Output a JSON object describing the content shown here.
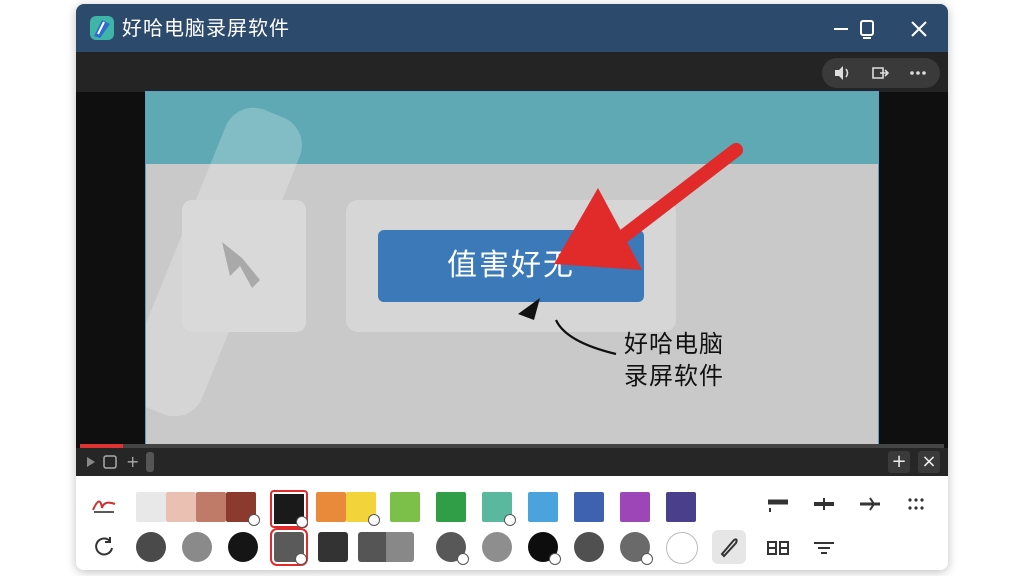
{
  "window": {
    "title": "好哈电脑录屏软件"
  },
  "title_controls": [
    "minimize-icon",
    "maximize-icon",
    "close-icon"
  ],
  "top_toolbar": {
    "icons": [
      "volume-icon",
      "export-icon",
      "more-icon"
    ]
  },
  "preview": {
    "button_text": "值害好无",
    "callout_line1": "好哈电脑",
    "callout_line2": "录屏软件"
  },
  "timeline": {
    "progress_fraction": 0.05,
    "add_label": "+",
    "close_label": "×"
  },
  "colors": {
    "titlebar": "#2c4a6b",
    "accent_red": "#e12a2a",
    "swatches_row1": [
      "#e8e8e8",
      "#eac0b3",
      "#c07a68",
      "#8c3a2e",
      "#1a1a1a",
      "#e88a3a",
      "#f2d33a",
      "#7cc04a",
      "#2f9e46",
      "#5ab89e",
      "#4aa3dd",
      "#3f62b0",
      "#9c46b8",
      "#4a3f8a"
    ],
    "dots_row2": [
      "#4a4a4a",
      "#8a8a8a",
      "#151515",
      "#5a5a5a",
      "#333333",
      "#585858",
      "#8e8e8e",
      "#0d0d0d",
      "#505050",
      "#6a6a6a",
      "#ffffff"
    ]
  },
  "tools_row1": [
    "signature-icon",
    "line-thick-icon",
    "line-center-icon",
    "line-arrow-icon",
    "dots-icon"
  ],
  "tools_row2": [
    "undo-circle-icon",
    "pen-icon",
    "text-columns-icon",
    "align-icon"
  ]
}
